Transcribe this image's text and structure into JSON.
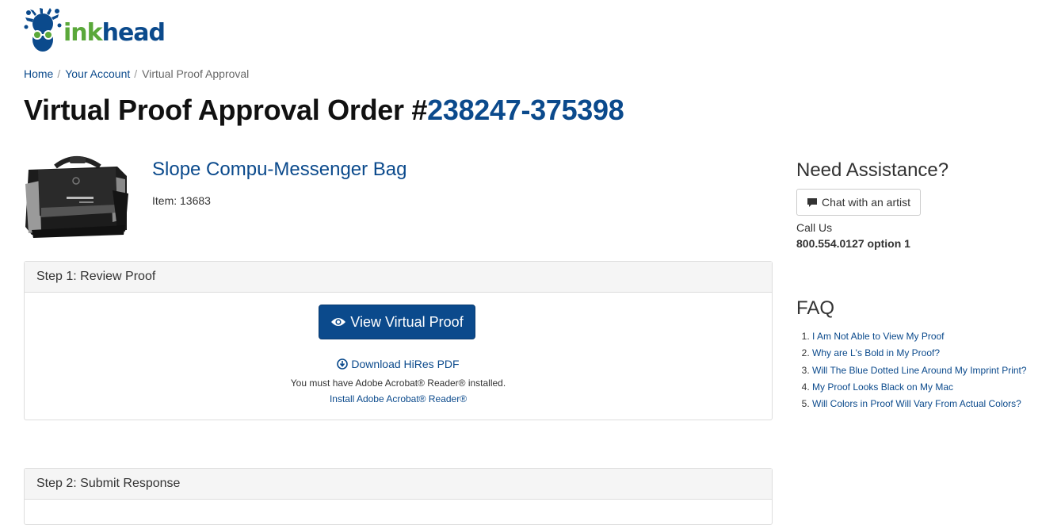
{
  "logo": {
    "text_ink": "ink",
    "text_head": "head",
    "colors": {
      "ink": "#5aa83a",
      "head": "#0b4a8c"
    }
  },
  "breadcrumb": {
    "items": [
      "Home",
      "Your Account"
    ],
    "current": "Virtual Proof Approval"
  },
  "page": {
    "title_prefix": "Virtual Proof Approval Order #",
    "order_number": "238247-375398"
  },
  "product": {
    "name": "Slope Compu-Messenger Bag",
    "item": "Item: 13683",
    "image_icon": "messenger-bag-image"
  },
  "step1": {
    "heading": "Step 1: Review Proof",
    "view_button": "View Virtual Proof",
    "view_icon": "eye-icon",
    "download_link": "Download HiRes PDF",
    "download_icon": "download-circle-icon",
    "acrobat_note": "You must have Adobe Acrobat® Reader® installed.",
    "install_link": "Install Adobe Acrobat® Reader®"
  },
  "step2": {
    "heading": "Step 2: Submit Response"
  },
  "sidebar": {
    "assistance_title": "Need Assistance?",
    "chat_button": "Chat with an artist",
    "chat_icon": "comment-icon",
    "call_label": "Call Us",
    "call_number": "800.554.0127 option 1",
    "faq_title": "FAQ",
    "faq_items": [
      "I Am Not Able to View My Proof",
      "Why are L's Bold in My Proof?",
      "Will The Blue Dotted Line Around My Imprint Print?",
      "My Proof Looks Black on My Mac",
      "Will Colors in Proof Will Vary From Actual Colors?"
    ]
  },
  "colors": {
    "brand_blue": "#0b4a8c",
    "panel_heading_bg": "#f5f5f5",
    "border": "#dddddd"
  }
}
